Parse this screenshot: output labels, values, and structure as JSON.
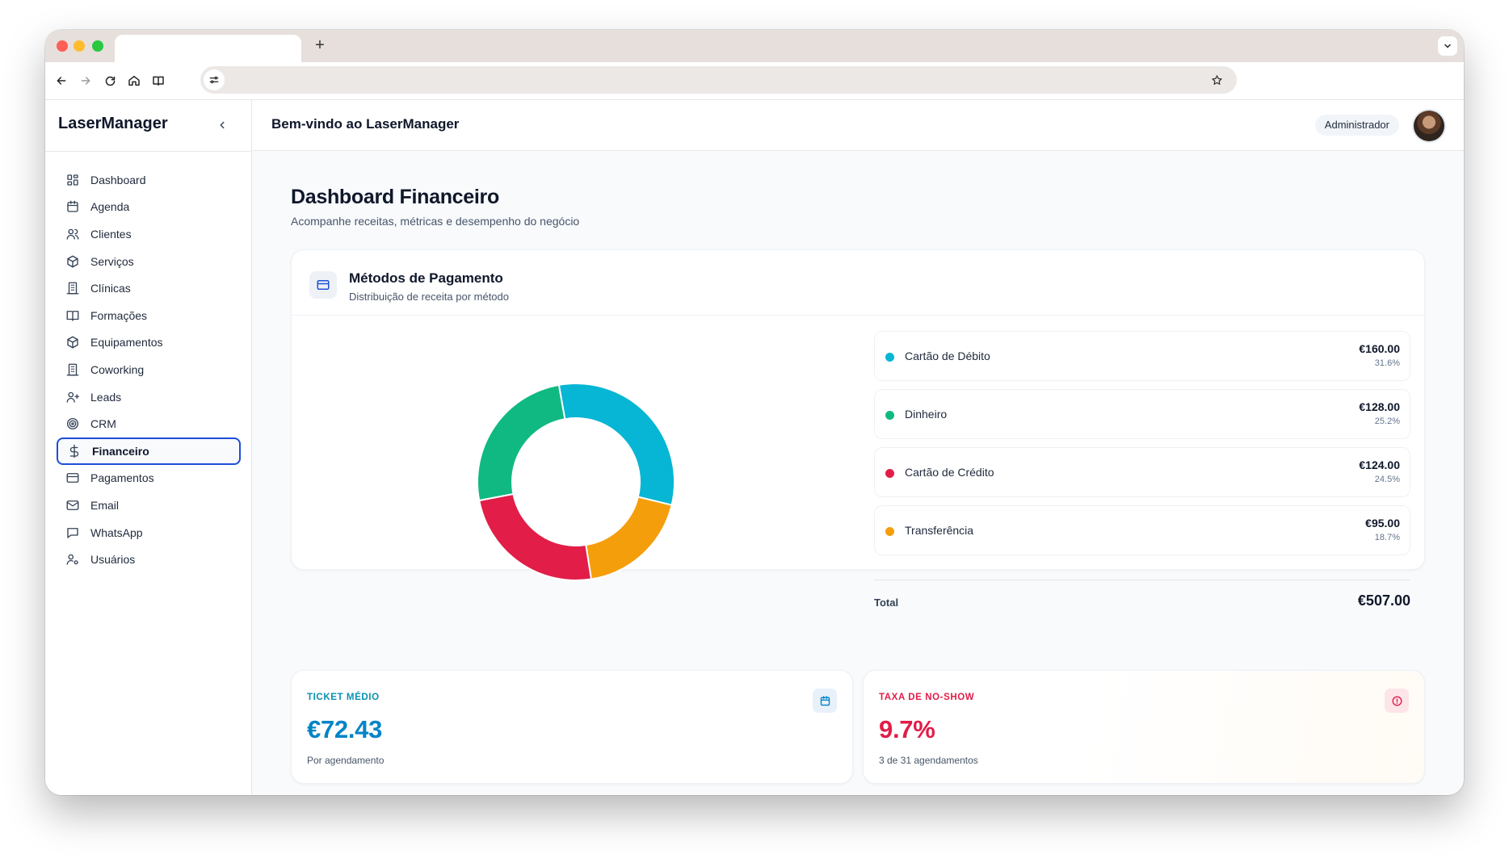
{
  "browser": {
    "new_tab": "+",
    "icons": [
      "back-icon",
      "forward-icon",
      "reload-icon",
      "home-icon",
      "reader-icon",
      "site-settings-icon",
      "bookmark-star-icon"
    ]
  },
  "sidebar": {
    "brand": "LaserManager",
    "items": [
      {
        "label": "Dashboard",
        "icon": "grid-icon"
      },
      {
        "label": "Agenda",
        "icon": "calendar-icon"
      },
      {
        "label": "Clientes",
        "icon": "users-icon"
      },
      {
        "label": "Serviços",
        "icon": "box-icon"
      },
      {
        "label": "Clínicas",
        "icon": "building-icon"
      },
      {
        "label": "Formações",
        "icon": "book-icon"
      },
      {
        "label": "Equipamentos",
        "icon": "box-icon"
      },
      {
        "label": "Coworking",
        "icon": "building-icon"
      },
      {
        "label": "Leads",
        "icon": "user-plus-icon"
      },
      {
        "label": "CRM",
        "icon": "target-icon"
      },
      {
        "label": "Financeiro",
        "icon": "dollar-icon",
        "active": true
      },
      {
        "label": "Pagamentos",
        "icon": "credit-card-icon"
      },
      {
        "label": "Email",
        "icon": "mail-icon"
      },
      {
        "label": "WhatsApp",
        "icon": "message-icon"
      },
      {
        "label": "Usuários",
        "icon": "user-cog-icon"
      }
    ]
  },
  "header": {
    "welcome": "Bem-vindo ao LaserManager",
    "role": "Administrador"
  },
  "page": {
    "title": "Dashboard Financeiro",
    "subtitle": "Acompanhe receitas, métricas e desempenho do negócio"
  },
  "payments": {
    "title": "Métodos de Pagamento",
    "subtitle": "Distribuição de receita por método",
    "total_label": "Total",
    "total_value": "€507.00"
  },
  "chart_data": {
    "type": "pie",
    "donut": true,
    "categories": [
      "Cartão de Débito",
      "Dinheiro",
      "Cartão de Crédito",
      "Transferência"
    ],
    "values": [
      160.0,
      128.0,
      124.0,
      95.0
    ],
    "amounts": [
      "€160.00",
      "€128.00",
      "€124.00",
      "€95.00"
    ],
    "percents": [
      "31.6%",
      "25.2%",
      "24.5%",
      "18.7%"
    ],
    "colors": [
      "#06b6d4",
      "#10b981",
      "#e11d48",
      "#f59e0b"
    ],
    "chart_order": [
      0,
      3,
      2,
      1
    ]
  },
  "kpis": {
    "ticket": {
      "label": "TICKET MÉDIO",
      "value": "€72.43",
      "sub": "Por agendamento",
      "color": "#0284c7",
      "icon": "calendar-icon"
    },
    "noshow": {
      "label": "TAXA DE NO-SHOW",
      "value": "9.7%",
      "sub": "3 de 31 agendamentos",
      "color": "#e11d48",
      "icon": "alert-circle-icon"
    }
  }
}
